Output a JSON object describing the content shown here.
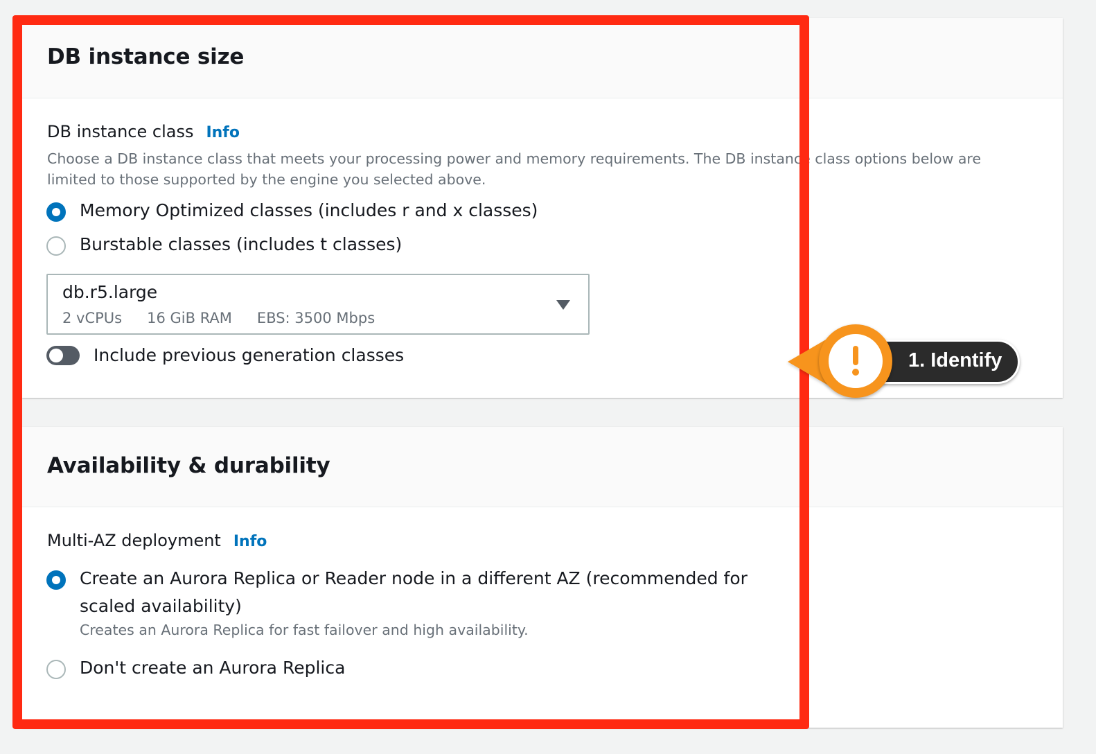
{
  "size_panel": {
    "title": "DB instance size",
    "class_label": "DB instance class",
    "info_link": "Info",
    "description": "Choose a DB instance class that meets your processing power and memory requirements. The DB instance class options below are limited to those supported by the engine you selected above.",
    "radio_options": [
      {
        "label": "Memory Optimized classes (includes r and x classes)",
        "checked": true
      },
      {
        "label": "Burstable classes (includes t classes)",
        "checked": false
      }
    ],
    "select": {
      "value": "db.r5.large",
      "vcpus": "2 vCPUs",
      "ram": "16 GiB RAM",
      "ebs": "EBS: 3500 Mbps"
    },
    "toggle": {
      "label": "Include previous generation classes",
      "on": false
    }
  },
  "avail_panel": {
    "title": "Availability & durability",
    "multi_az_label": "Multi-AZ deployment",
    "info_link": "Info",
    "radio_options": [
      {
        "label": "Create an Aurora Replica or Reader node in a different AZ (recommended for scaled availability)",
        "sub": "Creates an Aurora Replica for fast failover and high availability.",
        "checked": true
      },
      {
        "label": "Don't create an Aurora Replica",
        "checked": false
      }
    ]
  },
  "annotation": {
    "callout_text": "1. Identify",
    "icon": "exclamation-icon",
    "frame_color": "#ff2a12",
    "callout_color": "#f7941d"
  },
  "colors": {
    "link": "#0073bb",
    "radio_checked": "#0073bb",
    "text": "#16191f",
    "muted": "#687078"
  }
}
